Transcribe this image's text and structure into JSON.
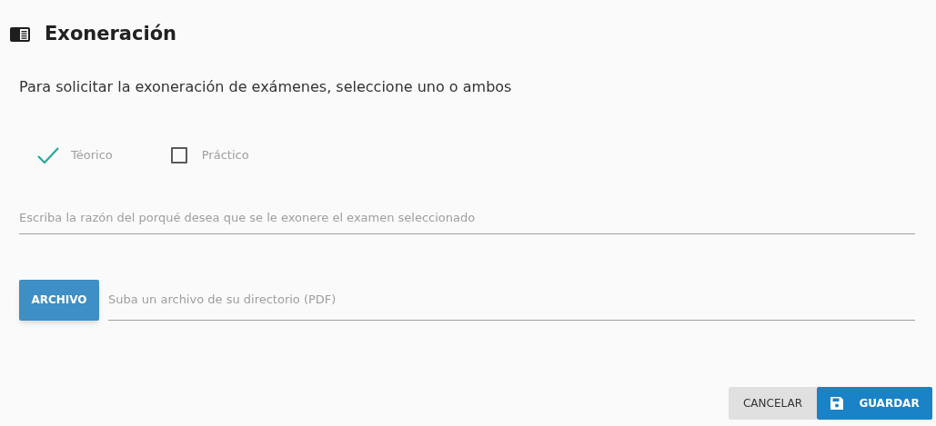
{
  "title": "Exoneración",
  "instruction": "Para solicitar la exoneración de exámenes, seleccione uno o ambos",
  "options": [
    {
      "label": "Téorico",
      "checked": true
    },
    {
      "label": "Práctico",
      "checked": false
    }
  ],
  "reason_field": {
    "placeholder": "Escriba la razón del porqué desea que se le exonere el examen seleccionado"
  },
  "file_button": "ARCHIVO",
  "file_field": {
    "placeholder": "Suba un archivo de su directorio (PDF)"
  },
  "buttons": [
    {
      "label": "CANCELAR",
      "kind": "secondary"
    },
    {
      "label": "GUARDAR",
      "kind": "primary"
    }
  ]
}
